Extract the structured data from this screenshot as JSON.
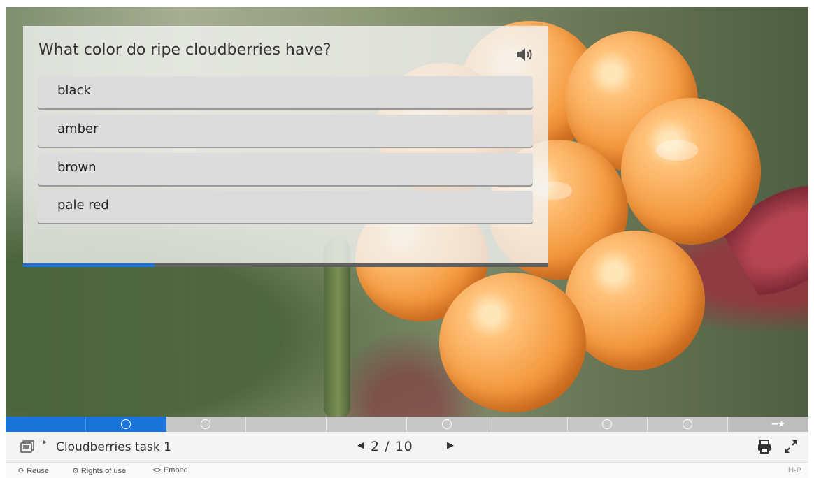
{
  "question": {
    "text": "What color do ripe cloudberries have?",
    "answers": [
      "black",
      "amber",
      "brown",
      "pale red"
    ],
    "progress_fraction": 0.25
  },
  "navigation": {
    "total_slides": 10,
    "current_slide": 2,
    "slides": [
      {
        "index": 1,
        "answered": true,
        "has_task": false
      },
      {
        "index": 2,
        "answered": true,
        "has_task": true
      },
      {
        "index": 3,
        "answered": false,
        "has_task": true
      },
      {
        "index": 4,
        "answered": false,
        "has_task": false
      },
      {
        "index": 5,
        "answered": false,
        "has_task": false
      },
      {
        "index": 6,
        "answered": false,
        "has_task": true
      },
      {
        "index": 7,
        "answered": false,
        "has_task": false
      },
      {
        "index": 8,
        "answered": false,
        "has_task": true
      },
      {
        "index": 9,
        "answered": false,
        "has_task": true
      },
      {
        "index": 10,
        "answered": false,
        "has_task": false,
        "summary": true
      }
    ]
  },
  "footer": {
    "title_separator": "‣",
    "task_title": "Cloudberries task 1",
    "prev_icon": "◀",
    "page_counter": "2 / 10",
    "next_icon": "▶"
  },
  "links": {
    "reuse": "Reuse",
    "rights": "Rights of use",
    "embed": "Embed",
    "embed_icon": "<>",
    "logo": "H-P"
  },
  "colors": {
    "accent": "#1a73d9",
    "nav_inactive": "#c7c7c7",
    "answer_bg": "#dcdcdc"
  }
}
